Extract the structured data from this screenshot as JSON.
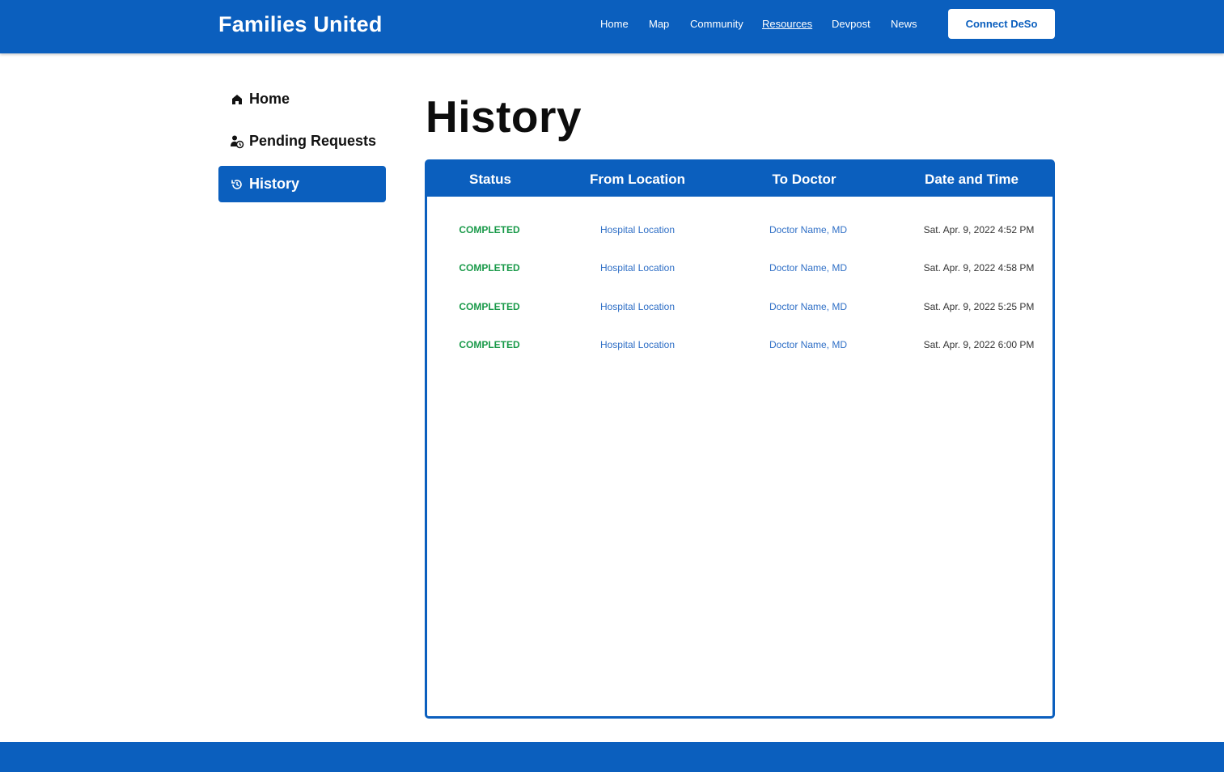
{
  "header": {
    "brand": "Families United",
    "nav": [
      {
        "label": "Home"
      },
      {
        "label": "Map"
      },
      {
        "label": "Community"
      },
      {
        "label": "Resources"
      },
      {
        "label": "Devpost"
      },
      {
        "label": "News"
      }
    ],
    "active_nav": "Resources",
    "connect_label": "Connect DeSo"
  },
  "sidebar": {
    "items": [
      {
        "label": "Home",
        "icon": "home-icon"
      },
      {
        "label": "Pending Requests",
        "icon": "user-clock-icon"
      },
      {
        "label": "History",
        "icon": "history-icon"
      }
    ],
    "active": "History"
  },
  "main": {
    "title": "History",
    "table": {
      "columns": [
        "Status",
        "From Location",
        "To Doctor",
        "Date and Time"
      ],
      "rows": [
        {
          "status": "COMPLETED",
          "from": "Hospital Location",
          "to": "Doctor Name, MD",
          "datetime": "Sat. Apr. 9, 2022 4:52 PM"
        },
        {
          "status": "COMPLETED",
          "from": "Hospital Location",
          "to": "Doctor Name, MD",
          "datetime": "Sat. Apr. 9, 2022 4:58 PM"
        },
        {
          "status": "COMPLETED",
          "from": "Hospital Location",
          "to": "Doctor Name, MD",
          "datetime": "Sat. Apr. 9, 2022 5:25 PM"
        },
        {
          "status": "COMPLETED",
          "from": "Hospital Location",
          "to": "Doctor Name, MD",
          "datetime": "Sat. Apr. 9, 2022 6:00 PM"
        }
      ]
    }
  },
  "colors": {
    "brand_blue": "#0b5fbe",
    "status_green": "#1a9a4a",
    "link_blue": "#2f6fc6"
  }
}
